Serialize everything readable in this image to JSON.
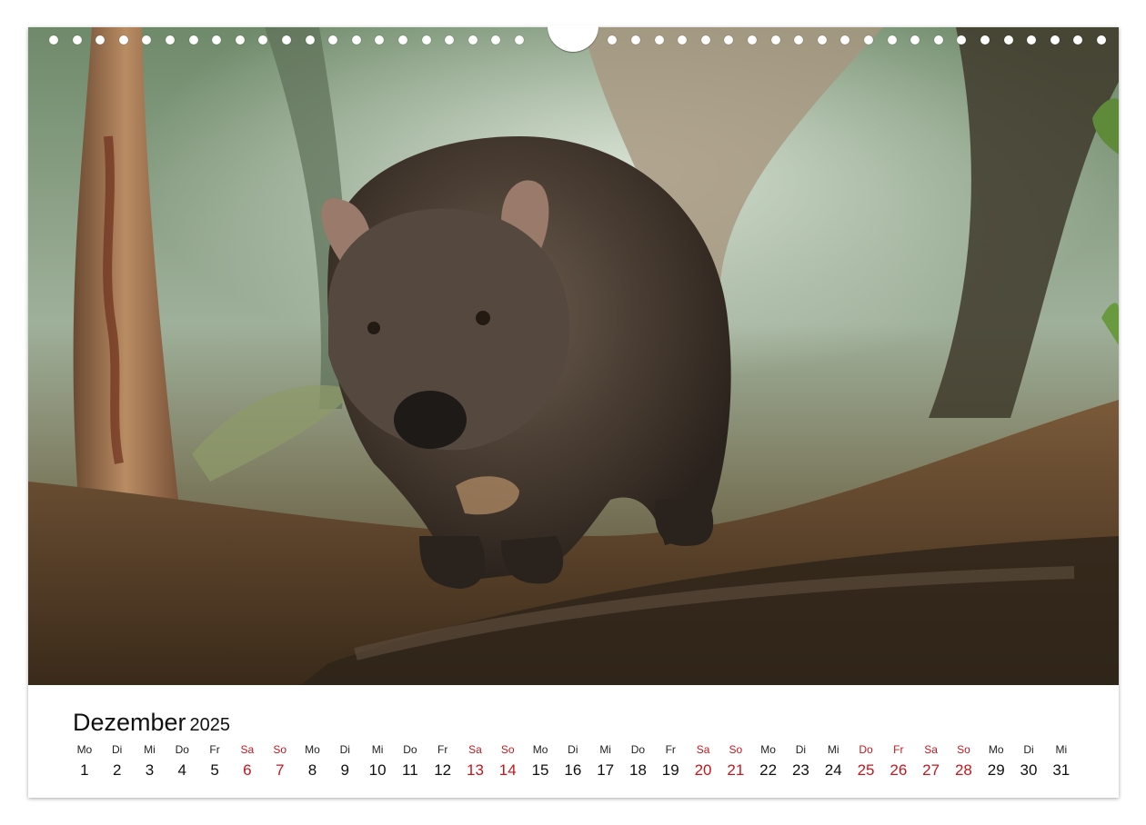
{
  "calendar": {
    "month": "Dezember",
    "year": "2025",
    "days": [
      {
        "wd": "Mo",
        "n": "1"
      },
      {
        "wd": "Di",
        "n": "2"
      },
      {
        "wd": "Mi",
        "n": "3"
      },
      {
        "wd": "Do",
        "n": "4"
      },
      {
        "wd": "Fr",
        "n": "5"
      },
      {
        "wd": "Sa",
        "n": "6"
      },
      {
        "wd": "So",
        "n": "7"
      },
      {
        "wd": "Mo",
        "n": "8"
      },
      {
        "wd": "Di",
        "n": "9"
      },
      {
        "wd": "Mi",
        "n": "10"
      },
      {
        "wd": "Do",
        "n": "11"
      },
      {
        "wd": "Fr",
        "n": "12"
      },
      {
        "wd": "Sa",
        "n": "13"
      },
      {
        "wd": "So",
        "n": "14"
      },
      {
        "wd": "Mo",
        "n": "15"
      },
      {
        "wd": "Di",
        "n": "16"
      },
      {
        "wd": "Mi",
        "n": "17"
      },
      {
        "wd": "Do",
        "n": "18"
      },
      {
        "wd": "Fr",
        "n": "19"
      },
      {
        "wd": "Sa",
        "n": "20"
      },
      {
        "wd": "So",
        "n": "21"
      },
      {
        "wd": "Mo",
        "n": "22"
      },
      {
        "wd": "Di",
        "n": "23"
      },
      {
        "wd": "Mi",
        "n": "24"
      },
      {
        "wd": "Do",
        "n": "25"
      },
      {
        "wd": "Fr",
        "n": "26"
      },
      {
        "wd": "Sa",
        "n": "27"
      },
      {
        "wd": "So",
        "n": "28"
      },
      {
        "wd": "Mo",
        "n": "29"
      },
      {
        "wd": "Di",
        "n": "30"
      },
      {
        "wd": "Mi",
        "n": "31"
      }
    ],
    "highlighted_days": [
      "6",
      "7",
      "13",
      "14",
      "20",
      "21",
      "25",
      "26",
      "27",
      "28"
    ],
    "highlight_color": "#c4161c"
  },
  "photo": {
    "subject": "wombat-in-forest"
  }
}
